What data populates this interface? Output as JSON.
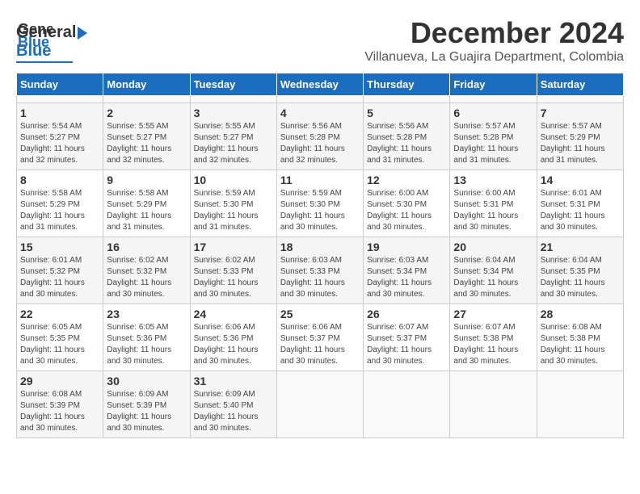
{
  "header": {
    "logo_line1": "General",
    "logo_line2": "Blue",
    "title": "December 2024",
    "subtitle": "Villanueva, La Guajira Department, Colombia"
  },
  "calendar": {
    "days_of_week": [
      "Sunday",
      "Monday",
      "Tuesday",
      "Wednesday",
      "Thursday",
      "Friday",
      "Saturday"
    ],
    "weeks": [
      [
        {
          "day": null,
          "info": ""
        },
        {
          "day": null,
          "info": ""
        },
        {
          "day": null,
          "info": ""
        },
        {
          "day": null,
          "info": ""
        },
        {
          "day": null,
          "info": ""
        },
        {
          "day": null,
          "info": ""
        },
        {
          "day": null,
          "info": ""
        }
      ],
      [
        {
          "day": 1,
          "sunrise": "5:54 AM",
          "sunset": "5:27 PM",
          "daylight": "11 hours and 32 minutes."
        },
        {
          "day": 2,
          "sunrise": "5:55 AM",
          "sunset": "5:27 PM",
          "daylight": "11 hours and 32 minutes."
        },
        {
          "day": 3,
          "sunrise": "5:55 AM",
          "sunset": "5:27 PM",
          "daylight": "11 hours and 32 minutes."
        },
        {
          "day": 4,
          "sunrise": "5:56 AM",
          "sunset": "5:28 PM",
          "daylight": "11 hours and 32 minutes."
        },
        {
          "day": 5,
          "sunrise": "5:56 AM",
          "sunset": "5:28 PM",
          "daylight": "11 hours and 31 minutes."
        },
        {
          "day": 6,
          "sunrise": "5:57 AM",
          "sunset": "5:28 PM",
          "daylight": "11 hours and 31 minutes."
        },
        {
          "day": 7,
          "sunrise": "5:57 AM",
          "sunset": "5:29 PM",
          "daylight": "11 hours and 31 minutes."
        }
      ],
      [
        {
          "day": 8,
          "sunrise": "5:58 AM",
          "sunset": "5:29 PM",
          "daylight": "11 hours and 31 minutes."
        },
        {
          "day": 9,
          "sunrise": "5:58 AM",
          "sunset": "5:29 PM",
          "daylight": "11 hours and 31 minutes."
        },
        {
          "day": 10,
          "sunrise": "5:59 AM",
          "sunset": "5:30 PM",
          "daylight": "11 hours and 31 minutes."
        },
        {
          "day": 11,
          "sunrise": "5:59 AM",
          "sunset": "5:30 PM",
          "daylight": "11 hours and 30 minutes."
        },
        {
          "day": 12,
          "sunrise": "6:00 AM",
          "sunset": "5:30 PM",
          "daylight": "11 hours and 30 minutes."
        },
        {
          "day": 13,
          "sunrise": "6:00 AM",
          "sunset": "5:31 PM",
          "daylight": "11 hours and 30 minutes."
        },
        {
          "day": 14,
          "sunrise": "6:01 AM",
          "sunset": "5:31 PM",
          "daylight": "11 hours and 30 minutes."
        }
      ],
      [
        {
          "day": 15,
          "sunrise": "6:01 AM",
          "sunset": "5:32 PM",
          "daylight": "11 hours and 30 minutes."
        },
        {
          "day": 16,
          "sunrise": "6:02 AM",
          "sunset": "5:32 PM",
          "daylight": "11 hours and 30 minutes."
        },
        {
          "day": 17,
          "sunrise": "6:02 AM",
          "sunset": "5:33 PM",
          "daylight": "11 hours and 30 minutes."
        },
        {
          "day": 18,
          "sunrise": "6:03 AM",
          "sunset": "5:33 PM",
          "daylight": "11 hours and 30 minutes."
        },
        {
          "day": 19,
          "sunrise": "6:03 AM",
          "sunset": "5:34 PM",
          "daylight": "11 hours and 30 minutes."
        },
        {
          "day": 20,
          "sunrise": "6:04 AM",
          "sunset": "5:34 PM",
          "daylight": "11 hours and 30 minutes."
        },
        {
          "day": 21,
          "sunrise": "6:04 AM",
          "sunset": "5:35 PM",
          "daylight": "11 hours and 30 minutes."
        }
      ],
      [
        {
          "day": 22,
          "sunrise": "6:05 AM",
          "sunset": "5:35 PM",
          "daylight": "11 hours and 30 minutes."
        },
        {
          "day": 23,
          "sunrise": "6:05 AM",
          "sunset": "5:36 PM",
          "daylight": "11 hours and 30 minutes."
        },
        {
          "day": 24,
          "sunrise": "6:06 AM",
          "sunset": "5:36 PM",
          "daylight": "11 hours and 30 minutes."
        },
        {
          "day": 25,
          "sunrise": "6:06 AM",
          "sunset": "5:37 PM",
          "daylight": "11 hours and 30 minutes."
        },
        {
          "day": 26,
          "sunrise": "6:07 AM",
          "sunset": "5:37 PM",
          "daylight": "11 hours and 30 minutes."
        },
        {
          "day": 27,
          "sunrise": "6:07 AM",
          "sunset": "5:38 PM",
          "daylight": "11 hours and 30 minutes."
        },
        {
          "day": 28,
          "sunrise": "6:08 AM",
          "sunset": "5:38 PM",
          "daylight": "11 hours and 30 minutes."
        }
      ],
      [
        {
          "day": 29,
          "sunrise": "6:08 AM",
          "sunset": "5:39 PM",
          "daylight": "11 hours and 30 minutes."
        },
        {
          "day": 30,
          "sunrise": "6:09 AM",
          "sunset": "5:39 PM",
          "daylight": "11 hours and 30 minutes."
        },
        {
          "day": 31,
          "sunrise": "6:09 AM",
          "sunset": "5:40 PM",
          "daylight": "11 hours and 30 minutes."
        },
        {
          "day": null,
          "info": ""
        },
        {
          "day": null,
          "info": ""
        },
        {
          "day": null,
          "info": ""
        },
        {
          "day": null,
          "info": ""
        }
      ]
    ]
  }
}
